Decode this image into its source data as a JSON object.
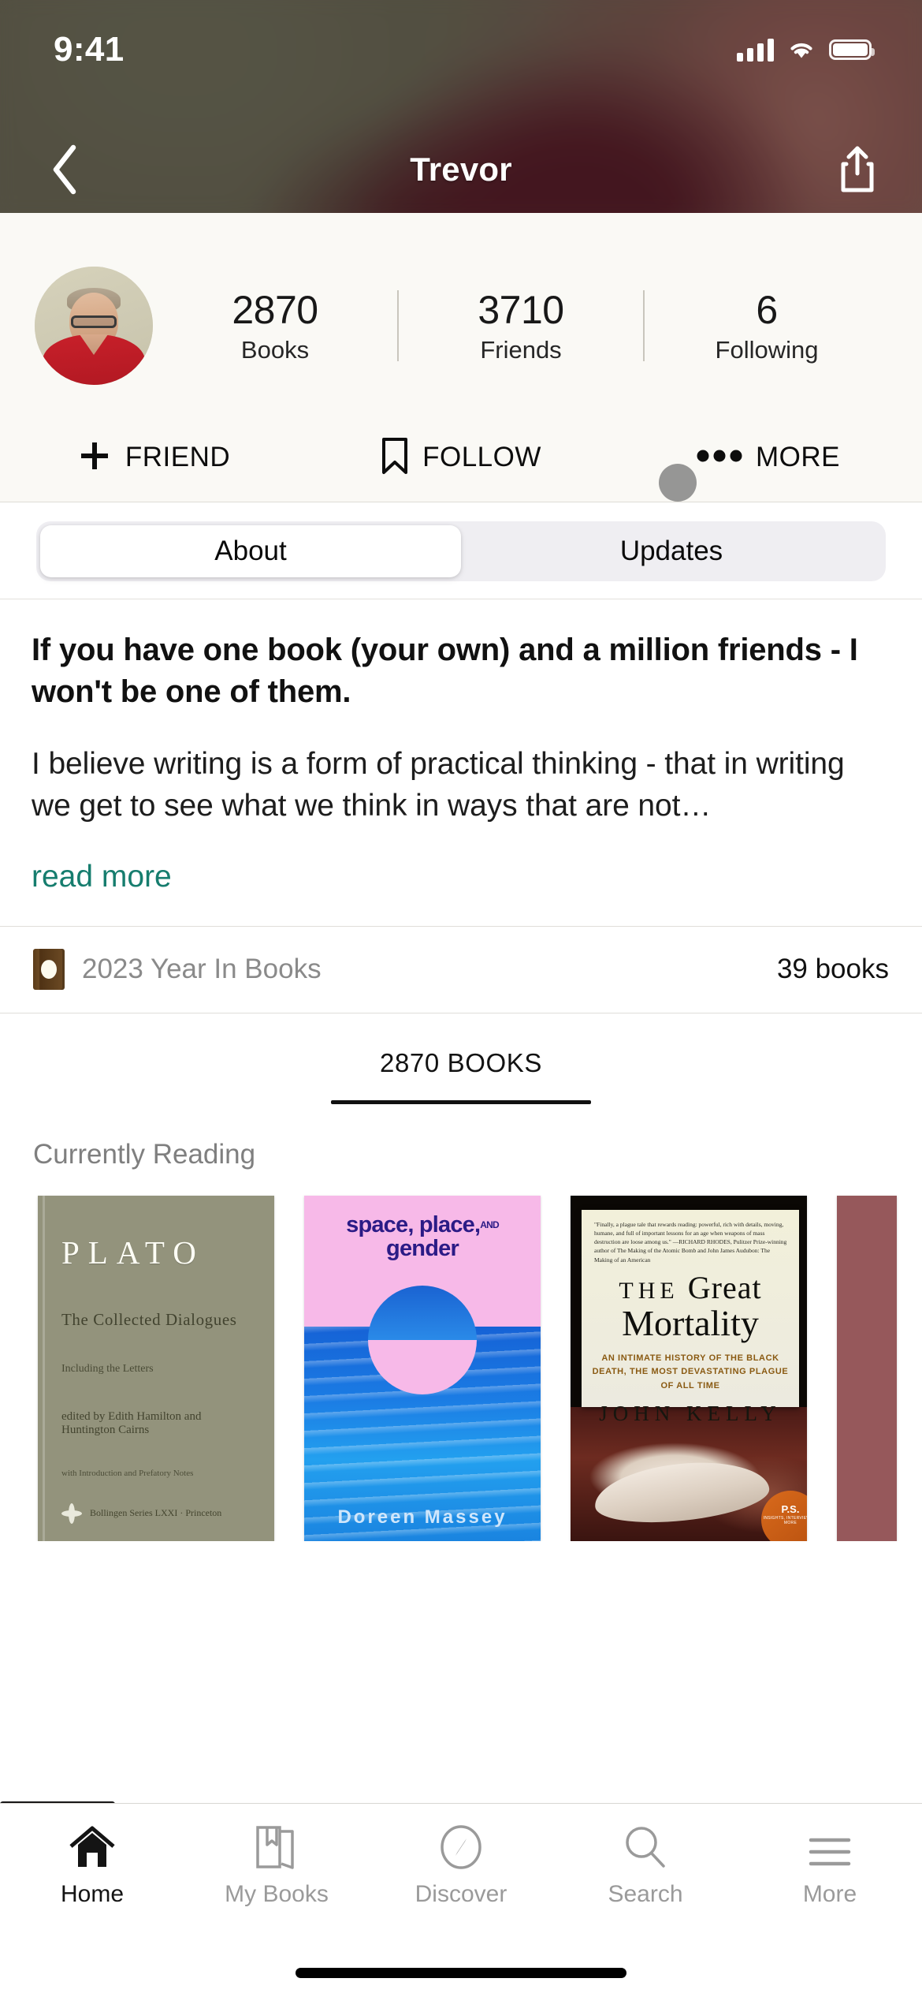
{
  "status_bar": {
    "time": "9:41",
    "signal_icon": "cellular-signal-icon",
    "wifi_icon": "wifi-icon",
    "battery_icon": "battery-full-icon"
  },
  "nav": {
    "back_icon": "chevron-left-icon",
    "title": "Trevor",
    "share_icon": "share-icon"
  },
  "profile": {
    "avatar_alt": "Trevor profile photo",
    "stats": [
      {
        "value": "2870",
        "label": "Books"
      },
      {
        "value": "3710",
        "label": "Friends"
      },
      {
        "value": "6",
        "label": "Following"
      }
    ],
    "actions": [
      {
        "icon": "plus-icon",
        "label": "FRIEND"
      },
      {
        "icon": "bookmark-icon",
        "label": "FOLLOW"
      },
      {
        "icon": "ellipsis-icon",
        "label": "MORE"
      }
    ]
  },
  "segmented": {
    "tabs": [
      {
        "label": "About",
        "selected": true
      },
      {
        "label": "Updates",
        "selected": false
      }
    ]
  },
  "bio": {
    "headline": "If you have one book (your own) and a million friends - I won't be one of them.",
    "body": "I believe writing is a form of practical thinking - that in writing we get to see what we think in ways that are not…",
    "read_more": "read more"
  },
  "year_in_books": {
    "icon": "book-award-icon",
    "label": "2023 Year In Books",
    "count": "39 books"
  },
  "books_section": {
    "tab_label": "2870 BOOKS",
    "shelf_title": "Currently Reading",
    "books": [
      {
        "id": "plato",
        "title": "PLATO",
        "subtitle": "The Collected Dialogues",
        "line3": "Including the Letters",
        "editors": "edited by Edith Hamilton and Huntington Cairns",
        "notes": "with Introduction and Prefatory Notes",
        "series": "Bollingen Series LXXI · Princeton",
        "color": "#93937c"
      },
      {
        "id": "space-place-gender",
        "title_a": "space, place,",
        "title_and": "AND",
        "title_b": "gender",
        "author": "Doreen Massey",
        "color": "#f7b9e8"
      },
      {
        "id": "great-mortality",
        "blurb": "\"Finally, a plague tale that rewards reading: powerful, rich with details, moving, humane, and full of important lessons for an age when weapons of mass destruction are loose among us.\" —RICHARD RHODES, Pulitzer Prize-winning author of The Making of the Atomic Bomb and John James Audubon: The Making of an American",
        "title_the": "THE",
        "title_great": "Great",
        "title_mortality": "Mortality",
        "subtitle": "AN INTIMATE HISTORY OF THE BLACK DEATH, THE MOST DEVASTATING PLAGUE OF ALL TIME",
        "author": "JOHN KELLY",
        "badge": "P.S.",
        "badge_sub": "INSIGHTS, INTERVIEWS & MORE",
        "color": "#0b0805"
      },
      {
        "id": "next-book-partial",
        "color": "#96585b"
      }
    ]
  },
  "tabbar": {
    "items": [
      {
        "icon": "home-icon",
        "label": "Home",
        "active": true
      },
      {
        "icon": "books-icon",
        "label": "My Books",
        "active": false
      },
      {
        "icon": "compass-icon",
        "label": "Discover",
        "active": false
      },
      {
        "icon": "search-icon",
        "label": "Search",
        "active": false
      },
      {
        "icon": "hamburger-icon",
        "label": "More",
        "active": false
      }
    ]
  },
  "colors": {
    "link": "#167d6e",
    "profile_bg": "#faf9f5",
    "accent_dark": "#111111"
  }
}
